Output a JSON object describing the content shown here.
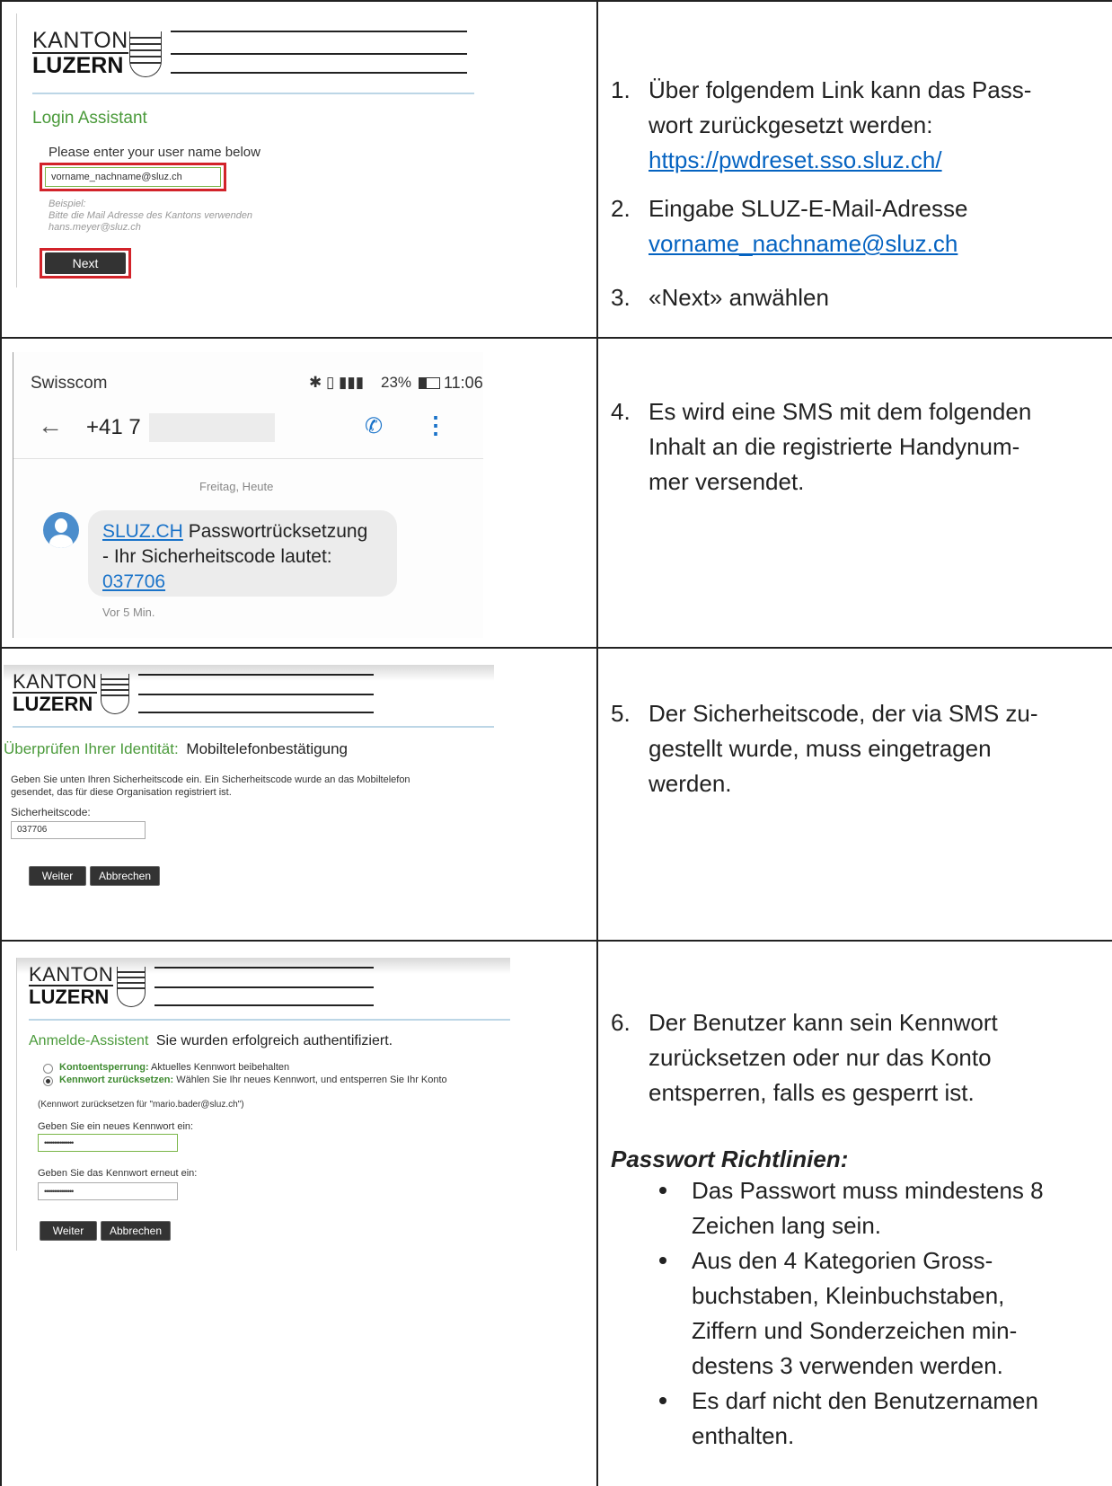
{
  "logo": {
    "kanton": "KANTON",
    "luzern": "LUZERN"
  },
  "row1": {
    "screen": {
      "title": "Login Assistant",
      "prompt": "Please enter your user name below",
      "input_value": "vorname_nachname@sluz.ch",
      "hint_title": "Beispiel:",
      "hint_line1": "Bitte die Mail Adresse des Kantons verwenden",
      "hint_line2": "hans.meyer@sluz.ch",
      "next_label": "Next"
    },
    "steps": [
      {
        "num": "1.",
        "line1": "Über folgendem Link kann das Pass-",
        "line2": "wort zurückgesetzt werden:",
        "link": "https://pwdreset.sso.sluz.ch/"
      },
      {
        "num": "2.",
        "line1": "Eingabe SLUZ-E-Mail-Adresse",
        "link": "vorname_nachname@sluz.ch"
      },
      {
        "num": "3.",
        "line1": "«Next» anwählen"
      }
    ]
  },
  "row2": {
    "phone": {
      "carrier": "Swisscom",
      "status": "23%",
      "time": "11:06",
      "contact": "+41 7",
      "date_label": "Freitag, Heute",
      "msg_link": "SLUZ.CH",
      "msg_text1": " Passwortrücksetzung",
      "msg_text2": "- Ihr Sicherheitscode lautet:",
      "msg_code": "037706",
      "age": "Vor 5 Min."
    },
    "step": {
      "num": "4.",
      "line1": "Es wird eine SMS mit dem folgenden",
      "line2": "Inhalt an die registrierte Handynum-",
      "line3": "mer versendet."
    }
  },
  "row3": {
    "screen": {
      "heading_green": "Überprüfen Ihrer Identität:",
      "heading_black": "Mobiltelefonbestätigung",
      "desc1": "Geben Sie unten Ihren Sicherheitscode ein. Ein Sicherheitscode wurde an das Mobiltelefon",
      "desc2": "gesendet, das für diese Organisation registriert ist.",
      "field_label": "Sicherheitscode:",
      "field_value": "037706",
      "weiter": "Weiter",
      "abbrechen": "Abbrechen"
    },
    "step": {
      "num": "5.",
      "line1": "Der Sicherheitscode, der via SMS zu-",
      "line2": "gestellt wurde, muss eingetragen",
      "line3": "werden."
    }
  },
  "row4": {
    "screen": {
      "heading_green": "Anmelde-Assistent",
      "heading_black": "Sie wurden erfolgreich authentifiziert.",
      "opt1_bold": "Kontoentsperrung:",
      "opt1_text": " Aktuelles Kennwort beibehalten",
      "opt2_bold": "Kennwort zurücksetzen:",
      "opt2_text": " Wählen Sie Ihr neues Kennwort, und entsperren Sie Ihr Konto",
      "note": "(Kennwort zurücksetzen für \"mario.bader@sluz.ch\")",
      "new_label": "Geben Sie ein neues Kennwort ein:",
      "new_value": "•••••••••••••••",
      "repeat_label": "Geben Sie das Kennwort erneut ein:",
      "repeat_value": "•••••••••••••••",
      "weiter": "Weiter",
      "abbrechen": "Abbrechen"
    },
    "step": {
      "num": "6.",
      "line1": "Der Benutzer kann sein Kennwort",
      "line2": "zurücksetzen oder nur das Konto",
      "line3": "entsperren, falls es gesperrt ist."
    },
    "policy": {
      "title": "Passwort Richtlinien:",
      "bullets": [
        {
          "l1": "Das Passwort muss mindestens 8",
          "l2": "Zeichen lang sein."
        },
        {
          "l1": "Aus den 4 Kategorien Gross-",
          "l2": "buchstaben, Kleinbuchstaben,",
          "l3": "Ziffern und Sonderzeichen min-",
          "l4": "destens 3 verwenden werden."
        },
        {
          "l1": "Es darf nicht den Benutzernamen",
          "l2": "enthalten."
        }
      ]
    }
  }
}
